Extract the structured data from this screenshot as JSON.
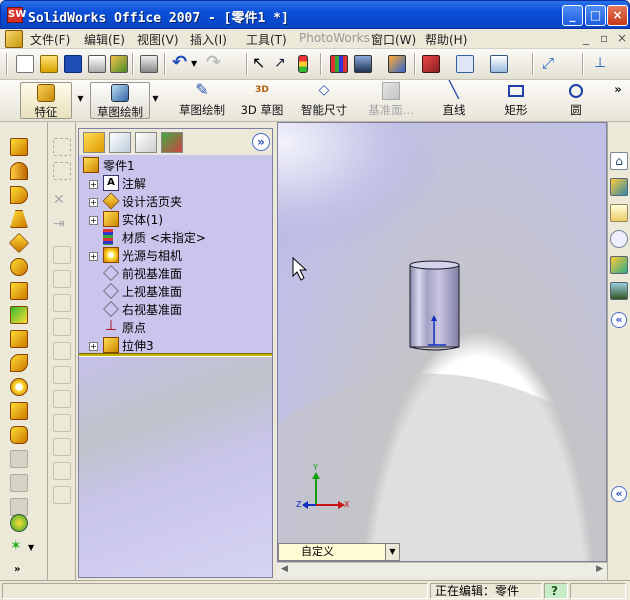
{
  "window": {
    "title": "SolidWorks Office 2007 - [零件1 *]",
    "logo": "SW",
    "buttons": [
      "minimize-icon",
      "maximize-icon",
      "close-icon"
    ]
  },
  "menu": {
    "items": [
      "文件(F)",
      "编辑(E)",
      "视图(V)",
      "插入(I)",
      "工具(T)",
      "PhotoWorks",
      "窗口(W)",
      "帮助(H)"
    ],
    "doc_controls": [
      "_",
      "▫",
      "×"
    ]
  },
  "command_manager": {
    "features_label": "特征",
    "sketch_label": "草图绘制",
    "sketch2_label": "草图绘制",
    "sketch3d_label": "3D 草图",
    "smart_dim_label": "智能尺寸",
    "ref_plane_label": "基准面...",
    "line_label": "直线",
    "rect_label": "矩形",
    "circle_label": "圆"
  },
  "feature_tree": {
    "root": "零件1",
    "items": [
      {
        "label": "注解",
        "expand": "+",
        "icon": "annotation-icon"
      },
      {
        "label": "设计活页夹",
        "expand": "+",
        "icon": "design-binder-icon"
      },
      {
        "label": "实体(1)",
        "expand": "+",
        "icon": "solid-bodies-icon"
      },
      {
        "label": "材质 <未指定>",
        "expand": "",
        "icon": "material-icon"
      },
      {
        "label": "光源与相机",
        "expand": "+",
        "icon": "lights-cameras-icon"
      },
      {
        "label": "前视基准面",
        "expand": "",
        "icon": "plane-icon"
      },
      {
        "label": "上视基准面",
        "expand": "",
        "icon": "plane-icon"
      },
      {
        "label": "右视基准面",
        "expand": "",
        "icon": "plane-icon"
      },
      {
        "label": "原点",
        "expand": "",
        "icon": "origin-icon"
      },
      {
        "label": "拉伸3",
        "expand": "+",
        "icon": "extrude-icon"
      }
    ],
    "expand_pane_label": "»"
  },
  "viewport": {
    "view_combo": "自定义",
    "axes": {
      "x": "X",
      "y": "Y",
      "z": "Z"
    }
  },
  "status": {
    "editing": "正在编辑：零件",
    "help": "?"
  },
  "colors": {
    "title_blue": "#0a4fd8",
    "tree_bg": "#c9c5ec",
    "viewport_bg": "#b6b4e2",
    "splitter": "#c8b400"
  }
}
